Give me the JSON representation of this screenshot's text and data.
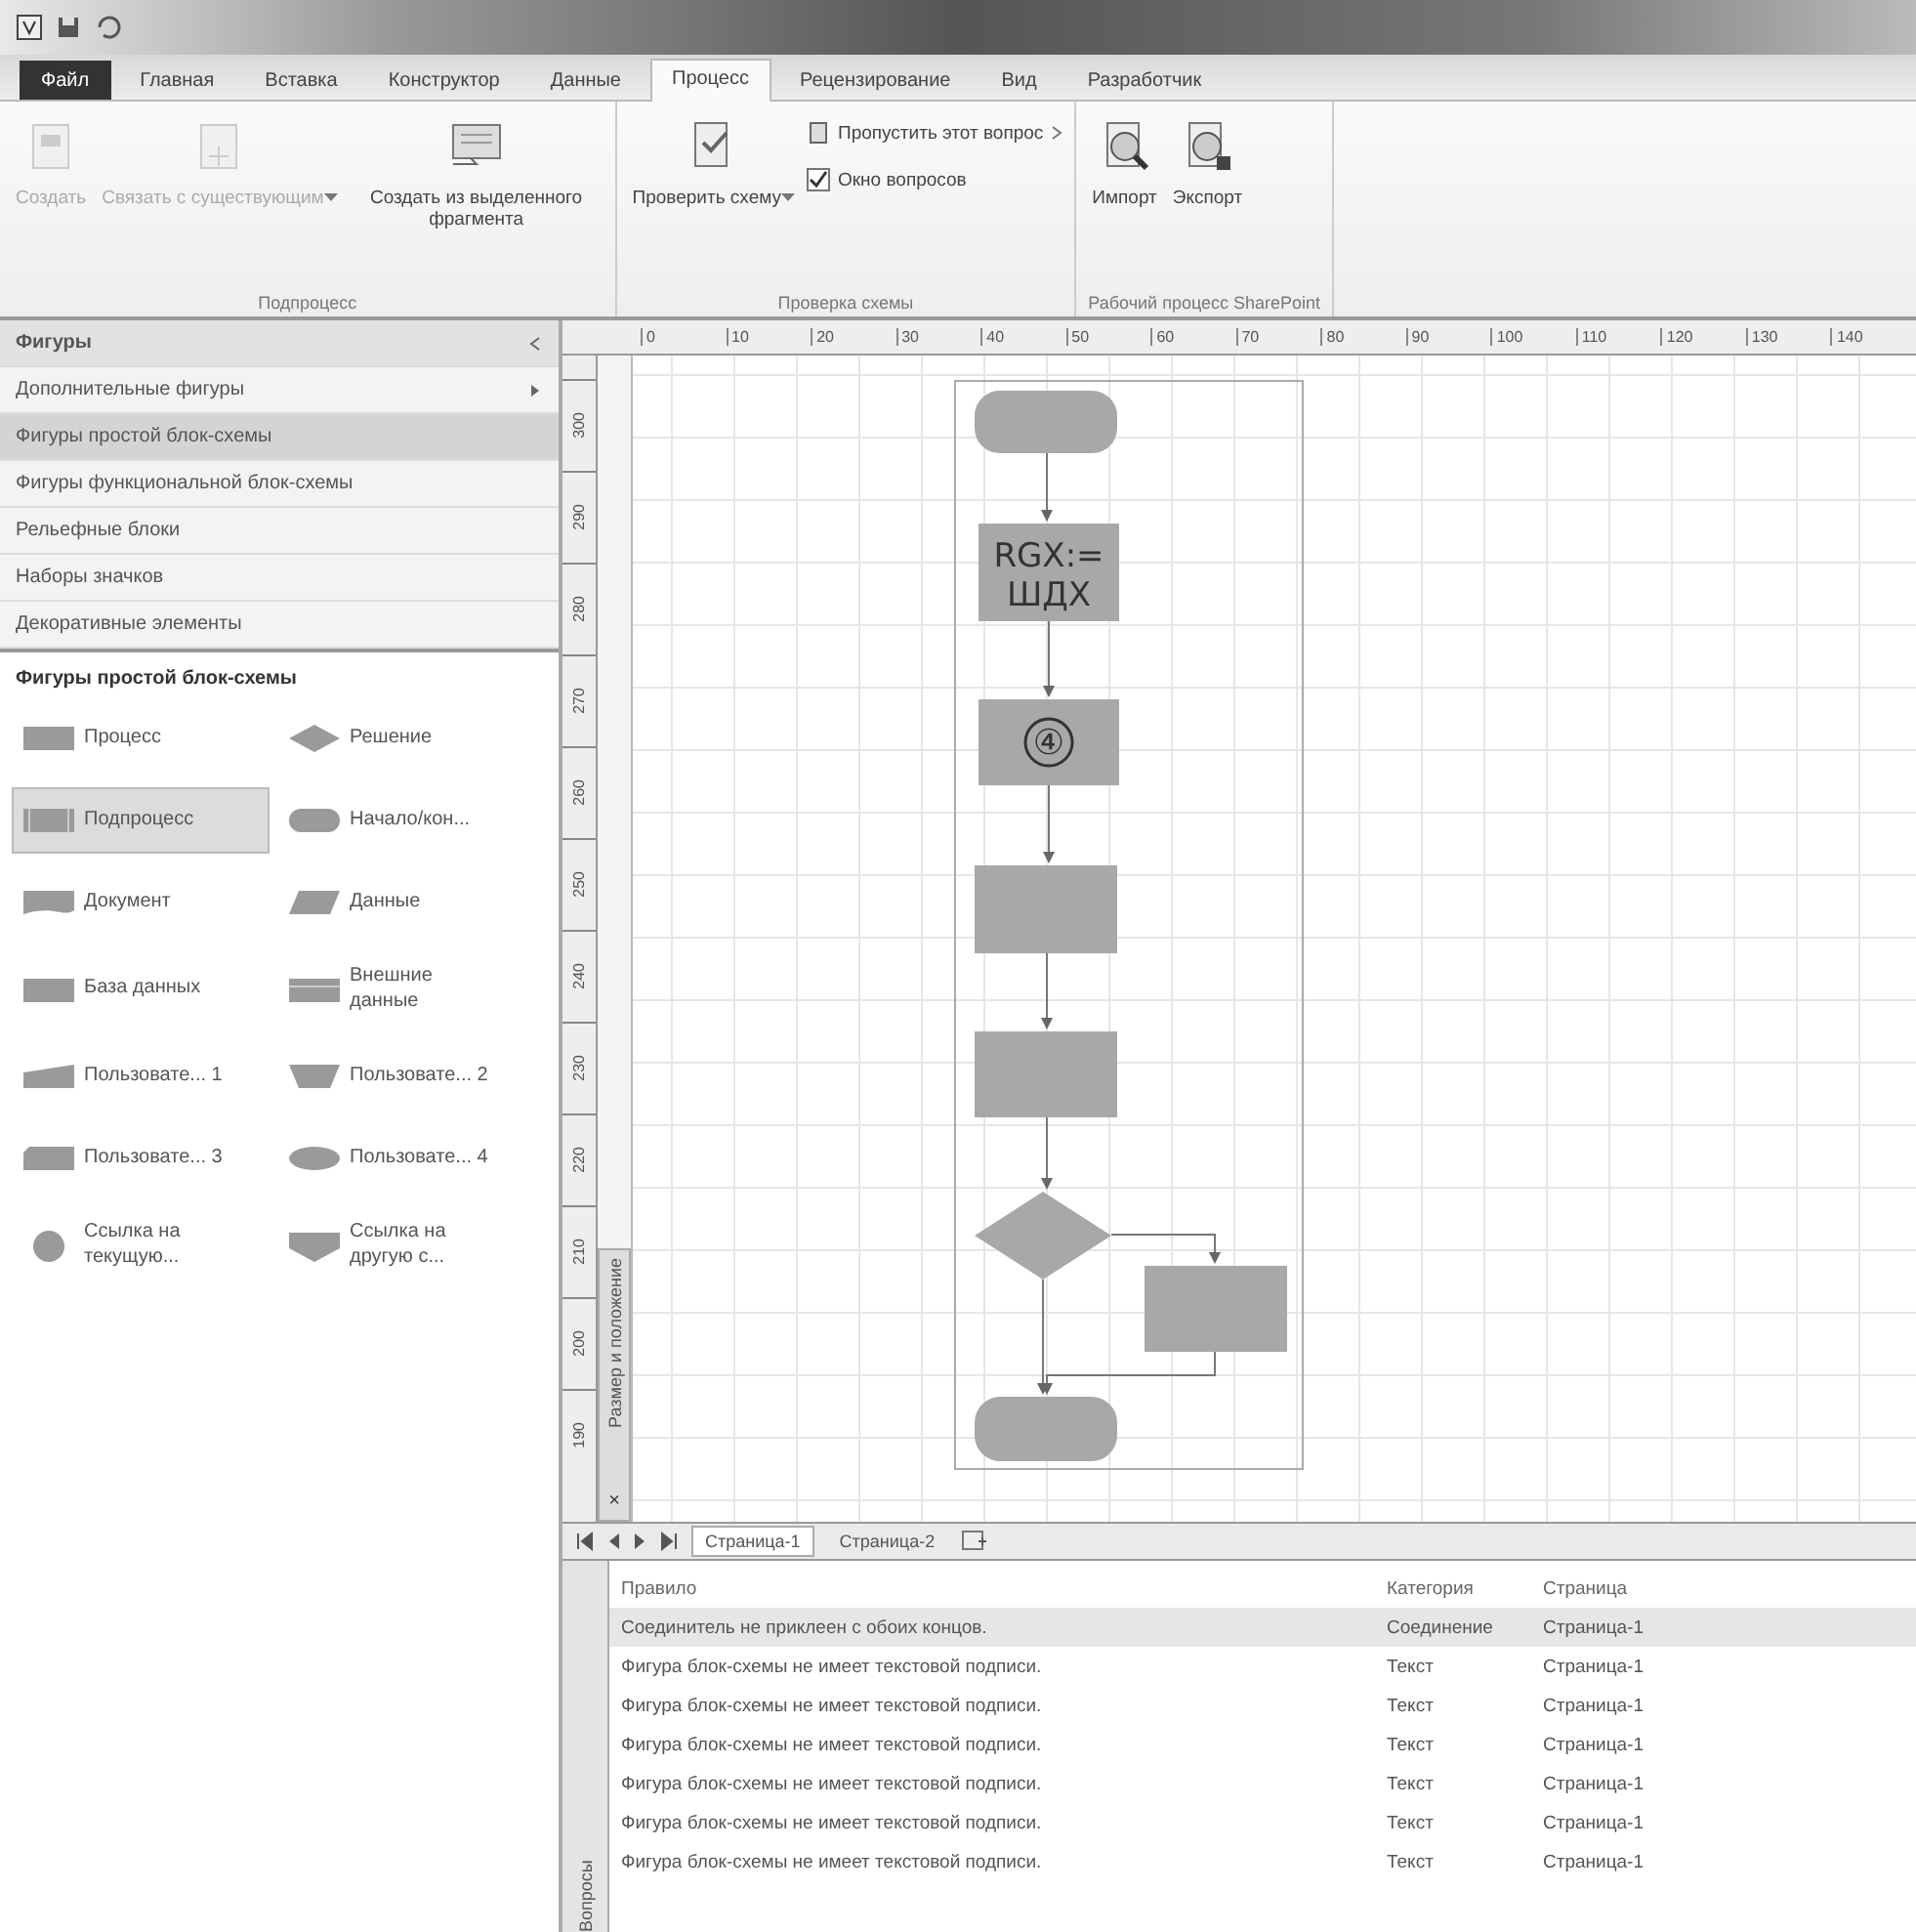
{
  "ribbon": {
    "tabs": [
      {
        "label": "Файл",
        "kind": "file",
        "selected": false
      },
      {
        "label": "Главная",
        "kind": "tab",
        "selected": false
      },
      {
        "label": "Вставка",
        "kind": "tab",
        "selected": false
      },
      {
        "label": "Конструктор",
        "kind": "tab",
        "selected": false
      },
      {
        "label": "Данные",
        "kind": "tab",
        "selected": false
      },
      {
        "label": "Процесс",
        "kind": "tab",
        "selected": true
      },
      {
        "label": "Рецензирование",
        "kind": "tab",
        "selected": false
      },
      {
        "label": "Вид",
        "kind": "tab",
        "selected": false
      },
      {
        "label": "Разработчик",
        "kind": "tab",
        "selected": false
      }
    ],
    "groups": [
      {
        "label": "Подпроцесс",
        "buttons": [
          {
            "kind": "large",
            "label": "Создать",
            "disabled": true,
            "dropdown": false
          },
          {
            "kind": "large",
            "label": "Связать с существующим",
            "disabled": true,
            "dropdown": true
          },
          {
            "kind": "large",
            "label": "Создать из выделенного фрагмента",
            "disabled": false,
            "dropdown": false
          }
        ]
      },
      {
        "label": "Проверка схемы",
        "buttons": [
          {
            "kind": "large",
            "label": "Проверить схему",
            "disabled": false,
            "dropdown": true
          },
          {
            "kind": "small",
            "label": "Пропустить этот вопрос",
            "disabled": false,
            "dropdown": true
          },
          {
            "kind": "checkbox",
            "label": "Окно вопросов",
            "checked": true,
            "disabled": false
          }
        ]
      },
      {
        "label": "Рабочий процесс SharePoint",
        "buttons": [
          {
            "kind": "large",
            "label": "Импорт",
            "disabled": false,
            "dropdown": false
          },
          {
            "kind": "large",
            "label": "Экспорт",
            "disabled": false,
            "dropdown": false
          }
        ]
      }
    ]
  },
  "shapes_panel": {
    "categories": [
      {
        "label": "Фигуры",
        "kind": "header",
        "selected": false
      },
      {
        "label": "Дополнительные фигуры",
        "kind": "more",
        "selected": false
      },
      {
        "label": "Фигуры простой блок-схемы",
        "kind": "stencil",
        "selected": true
      },
      {
        "label": "Фигуры функциональной блок-схемы",
        "kind": "stencil",
        "selected": false
      },
      {
        "label": "Рельефные блоки",
        "kind": "stencil",
        "selected": false
      },
      {
        "label": "Наборы значков",
        "kind": "stencil",
        "selected": false
      },
      {
        "label": "Декоративные элементы",
        "kind": "stencil",
        "selected": false
      }
    ],
    "stencil_title": "Фигуры простой блок-схемы",
    "shapes": [
      {
        "label": "Процесс",
        "kind": "process",
        "selected": false
      },
      {
        "label": "Решение",
        "kind": "decision",
        "selected": false
      },
      {
        "label": "Подпроцесс",
        "kind": "subprocess",
        "selected": true
      },
      {
        "label": "Начало/кон...",
        "kind": "terminator",
        "selected": false
      },
      {
        "label": "Документ",
        "kind": "document",
        "selected": false
      },
      {
        "label": "Данные",
        "kind": "data",
        "selected": false
      },
      {
        "label": "База данных",
        "kind": "database",
        "selected": false
      },
      {
        "label": "Внешние данные",
        "kind": "external",
        "selected": false
      },
      {
        "label": "Пользовате... 1",
        "kind": "custom1",
        "selected": false
      },
      {
        "label": "Пользовате... 2",
        "kind": "custom2",
        "selected": false
      },
      {
        "label": "Пользовате... 3",
        "kind": "custom3",
        "selected": false
      },
      {
        "label": "Пользовате... 4",
        "kind": "custom4",
        "selected": false
      },
      {
        "label": "Ссылка на текущую...",
        "kind": "onpage",
        "selected": false
      },
      {
        "label": "Ссылка на другую с...",
        "kind": "offpage",
        "selected": false
      }
    ]
  },
  "rulers": {
    "horizontal": [
      "0",
      "10",
      "20",
      "30",
      "40",
      "50",
      "60",
      "70",
      "80",
      "90",
      "100",
      "110",
      "120",
      "130",
      "140"
    ],
    "vertical": [
      "300",
      "290",
      "280",
      "270",
      "260",
      "250",
      "240",
      "230",
      "220",
      "210",
      "200",
      "190"
    ]
  },
  "size_panel": {
    "label": "Размер и положение",
    "close": "×"
  },
  "diagram": {
    "nodes": [
      {
        "kind": "terminator"
      },
      {
        "kind": "process",
        "text": "RGX:= ШДХ"
      },
      {
        "kind": "subprocess",
        "text": "④"
      },
      {
        "kind": "process"
      },
      {
        "kind": "process"
      },
      {
        "kind": "decision"
      },
      {
        "kind": "process"
      },
      {
        "kind": "terminator"
      }
    ]
  },
  "page_tabs": [
    {
      "label": "Страница-1",
      "selected": true
    },
    {
      "label": "Страница-2",
      "selected": false
    }
  ],
  "issues": {
    "side_label": "Вопросы",
    "columns": [
      "Правило",
      "Категория",
      "Страница"
    ],
    "rows": [
      {
        "rule": "Соединитель не приклеен с обоих концов.",
        "category": "Соединение",
        "page": "Страница-1",
        "selected": true
      },
      {
        "rule": "Фигура блок-схемы не имеет текстовой подписи.",
        "category": "Текст",
        "page": "Страница-1",
        "selected": false
      },
      {
        "rule": "Фигура блок-схемы не имеет текстовой подписи.",
        "category": "Текст",
        "page": "Страница-1",
        "selected": false
      },
      {
        "rule": "Фигура блок-схемы не имеет текстовой подписи.",
        "category": "Текст",
        "page": "Страница-1",
        "selected": false
      },
      {
        "rule": "Фигура блок-схемы не имеет текстовой подписи.",
        "category": "Текст",
        "page": "Страница-1",
        "selected": false
      },
      {
        "rule": "Фигура блок-схемы не имеет текстовой подписи.",
        "category": "Текст",
        "page": "Страница-1",
        "selected": false
      },
      {
        "rule": "Фигура блок-схемы не имеет текстовой подписи.",
        "category": "Текст",
        "page": "Страница-1",
        "selected": false
      }
    ]
  }
}
